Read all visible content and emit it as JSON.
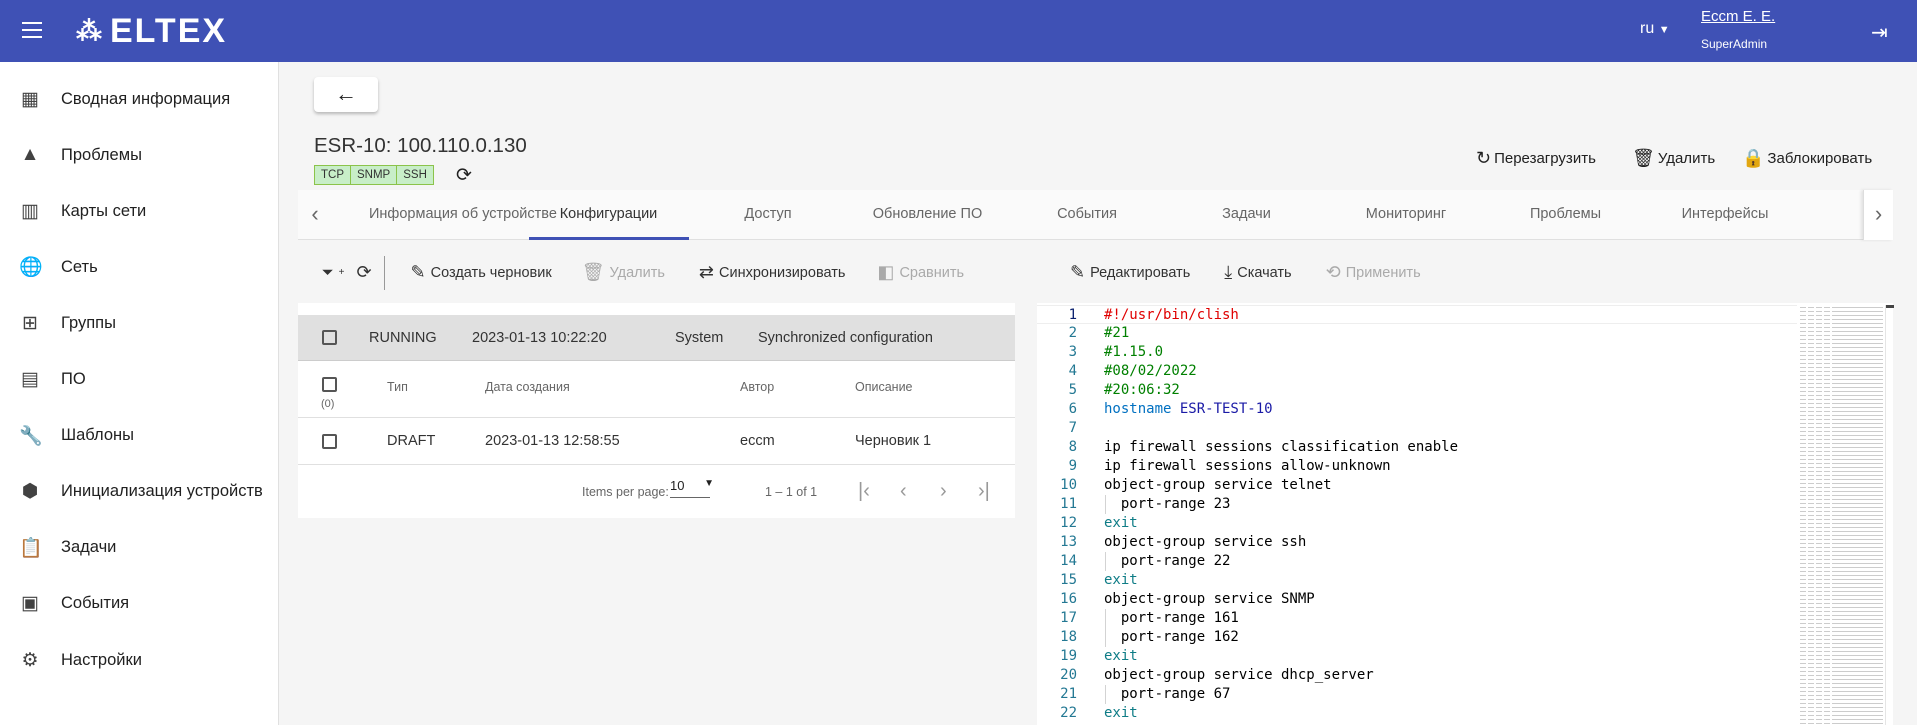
{
  "header": {
    "logo": "ELTEX",
    "lang": "ru",
    "user": "Eccm E. E.",
    "role": "SuperAdmin"
  },
  "sidebar": {
    "items": [
      {
        "label": "Сводная информация",
        "icon": "dashboard-icon",
        "glyph": "▦"
      },
      {
        "label": "Проблемы",
        "icon": "warning-icon",
        "glyph": "▲"
      },
      {
        "label": "Карты сети",
        "icon": "map-icon",
        "glyph": "▥"
      },
      {
        "label": "Сеть",
        "icon": "globe-icon",
        "glyph": "🌐"
      },
      {
        "label": "Группы",
        "icon": "groups-icon",
        "glyph": "⊞"
      },
      {
        "label": "ПО",
        "icon": "store-icon",
        "glyph": "▤"
      },
      {
        "label": "Шаблоны",
        "icon": "wrench-icon",
        "glyph": "🔧"
      },
      {
        "label": "Инициализация устройств",
        "icon": "init-icon",
        "glyph": "⬢"
      },
      {
        "label": "Задачи",
        "icon": "clipboard-icon",
        "glyph": "📋"
      },
      {
        "label": "События",
        "icon": "calendar-icon",
        "glyph": "▣"
      },
      {
        "label": "Настройки",
        "icon": "gear-icon",
        "glyph": "⚙"
      }
    ]
  },
  "device": {
    "title": "ESR-10: 100.110.0.130",
    "badges": [
      "TCP",
      "SNMP",
      "SSH"
    ],
    "actions": {
      "reboot": "Перезагрузить",
      "delete": "Удалить",
      "lock": "Заблокировать"
    }
  },
  "tabs": [
    "Информация об устройстве",
    "Конфигурации",
    "Доступ",
    "Обновление ПО",
    "События",
    "Задачи",
    "Мониторинг",
    "Проблемы",
    "Интерфейсы"
  ],
  "active_tab": "Конфигурации",
  "left": {
    "toolbar": {
      "create": "Создать черновик",
      "delete": "Удалить",
      "sync": "Синхронизировать",
      "compare": "Сравнить"
    },
    "running": {
      "type": "RUNNING",
      "date": "2023-01-13 10:22:20",
      "author": "System",
      "description": "Synchronized configuration"
    },
    "columns": {
      "count": "(0)",
      "type": "Тип",
      "date": "Дата создания",
      "author": "Автор",
      "description": "Описание"
    },
    "rows": [
      {
        "type": "DRAFT",
        "date": "2023-01-13 12:58:55",
        "author": "eccm",
        "description": "Черновик 1"
      }
    ],
    "paginator": {
      "label": "Items per page:",
      "size": "10",
      "range": "1 – 1 of 1"
    }
  },
  "right": {
    "toolbar": {
      "edit": "Редактировать",
      "download": "Скачать",
      "apply": "Применить"
    },
    "code": [
      [
        [
          "#!/usr/bin/clish",
          "red"
        ]
      ],
      [
        [
          "#21",
          "com"
        ]
      ],
      [
        [
          "#1.15.0",
          "com"
        ]
      ],
      [
        [
          "#08/02/2022",
          "com"
        ]
      ],
      [
        [
          "#20:06:32",
          "com"
        ]
      ],
      [
        [
          "hostname ",
          "key"
        ],
        [
          "ESR-TEST-10",
          "val"
        ]
      ],
      [
        [
          "",
          ""
        ]
      ],
      [
        [
          "ip firewall sessions classification enable",
          "plain"
        ]
      ],
      [
        [
          "ip firewall sessions allow-unknown",
          "plain"
        ]
      ],
      [
        [
          "object-group service telnet",
          "plain"
        ]
      ],
      [
        [
          "  port-range 23",
          "plain"
        ]
      ],
      [
        [
          "exit",
          "teal"
        ]
      ],
      [
        [
          "object-group service ssh",
          "plain"
        ]
      ],
      [
        [
          "  port-range 22",
          "plain"
        ]
      ],
      [
        [
          "exit",
          "teal"
        ]
      ],
      [
        [
          "object-group service SNMP",
          "plain"
        ]
      ],
      [
        [
          "  port-range 161",
          "plain"
        ]
      ],
      [
        [
          "  port-range 162",
          "plain"
        ]
      ],
      [
        [
          "exit",
          "teal"
        ]
      ],
      [
        [
          "object-group service dhcp_server",
          "plain"
        ]
      ],
      [
        [
          "  port-range 67",
          "plain"
        ]
      ],
      [
        [
          "exit",
          "teal"
        ]
      ]
    ]
  }
}
